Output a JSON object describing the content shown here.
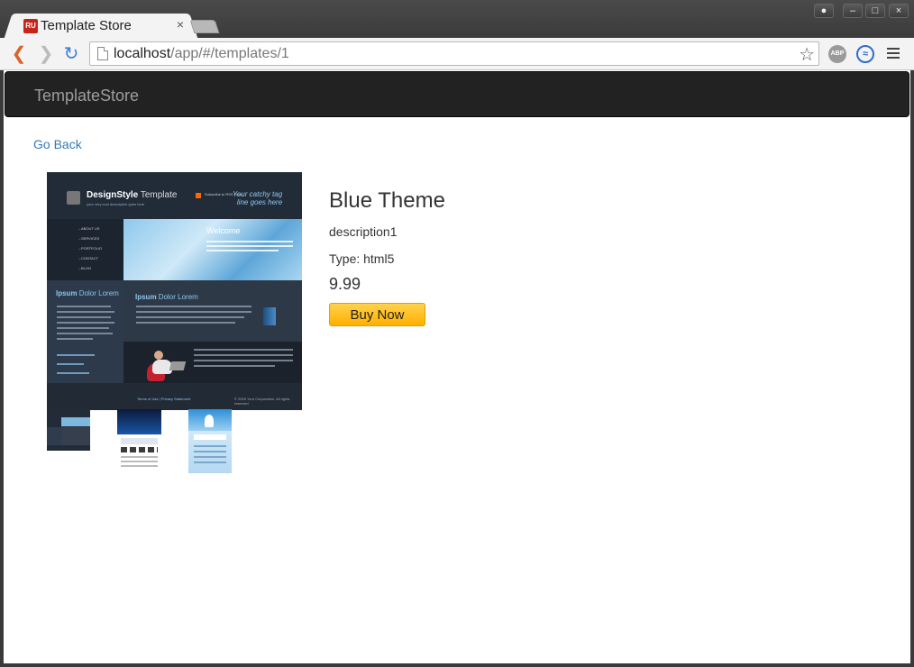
{
  "browser": {
    "tab_title": "Template Store",
    "tab_favicon_text": "RU",
    "tab_close": "×",
    "url_host": "localhost",
    "url_path": "/app/#/templates/1",
    "extension_abp": "ABP"
  },
  "navbar": {
    "brand": "TemplateStore"
  },
  "page": {
    "go_back": "Go Back"
  },
  "preview": {
    "logo_bold": "DesignStyle",
    "logo_light": " Template",
    "logo_sub": "your very cool description goes here",
    "rss_text": "Subscribe to RSS Feed",
    "catchy_line1": "Your catchy tag",
    "catchy_line2": "line goes here",
    "nav": [
      "ABOUT US",
      "SERVICES",
      "PORTFOLIO",
      "CONTACT",
      "BLOG"
    ],
    "welcome": "Welcome",
    "side_title_bold": "Ipsum",
    "side_title_light": " Dolor Lorem",
    "content_title_bold": "Ipsum",
    "content_title_light": " Dolor Lorem",
    "footer_left": "Terms of Use | Privacy Statement",
    "footer_right": "© 2009 Your Corporation. All rights reserved"
  },
  "product": {
    "title": "Blue Theme",
    "description": "description1",
    "type": "Type: html5",
    "price": "9.99",
    "buy_label": "Buy Now"
  },
  "colors": {
    "link": "#337ab7",
    "navbar_bg": "#222222",
    "buy_button": "#ffc13b"
  }
}
